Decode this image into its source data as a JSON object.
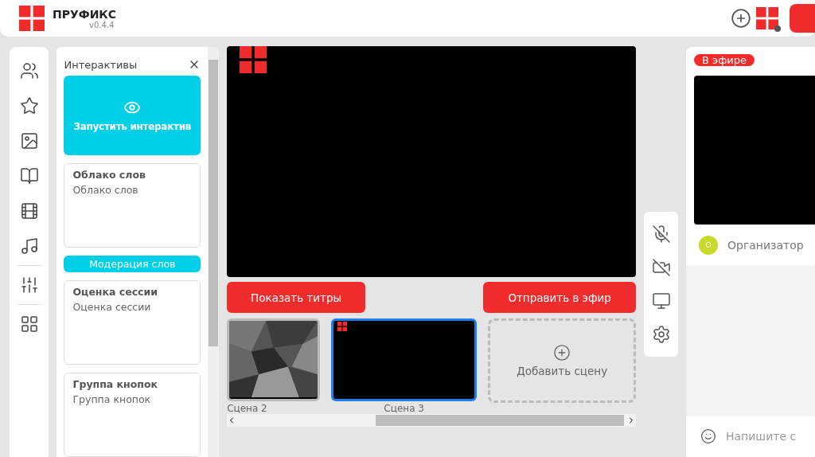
{
  "header": {
    "brand": "ПРУФИКС",
    "version": "v0.4.4"
  },
  "interactives": {
    "title": "Интерактивы",
    "launch_label": "Запустить интерактив",
    "items": [
      {
        "kind": "card",
        "title": "Облако слов",
        "subtitle": "Облако слов"
      },
      {
        "kind": "button",
        "title": "Модерация слов"
      },
      {
        "kind": "card",
        "title": "Оценка сессии",
        "subtitle": "Оценка сессии"
      },
      {
        "kind": "card",
        "title": "Группа кнопок",
        "subtitle": "Группа кнопок"
      }
    ]
  },
  "stage": {
    "show_titles": "Показать титры",
    "send_live": "Отправить в эфир",
    "scenes": [
      {
        "label": "Сцена 2",
        "kind": "picture",
        "selected": false
      },
      {
        "label": "Сцена 3",
        "kind": "blank",
        "selected": true
      }
    ],
    "add_scene": "Добавить сцену"
  },
  "live": {
    "badge": "В эфире",
    "avatar": "О",
    "participant": "Организатор",
    "chat_placeholder": "Напишите с"
  }
}
